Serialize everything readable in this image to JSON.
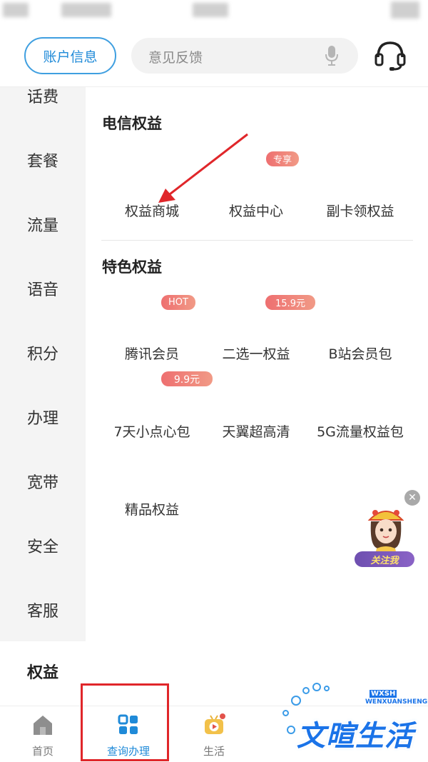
{
  "header": {
    "account_label": "账户信息",
    "search_placeholder": "意见反馈"
  },
  "sidebar": {
    "items": [
      {
        "label": "话费"
      },
      {
        "label": "套餐"
      },
      {
        "label": "流量"
      },
      {
        "label": "语音"
      },
      {
        "label": "积分"
      },
      {
        "label": "办理"
      },
      {
        "label": "宽带"
      },
      {
        "label": "安全"
      },
      {
        "label": "客服"
      },
      {
        "label": "权益",
        "active": true
      }
    ]
  },
  "main": {
    "telecom_section": {
      "title": "电信权益",
      "items": [
        {
          "label": "权益商城"
        },
        {
          "label": "权益中心",
          "badge": "专享"
        },
        {
          "label": "副卡领权益"
        }
      ]
    },
    "special_section": {
      "title": "特色权益",
      "items": [
        {
          "label": "腾讯会员",
          "badge": "HOT"
        },
        {
          "label": "二选一权益",
          "badge": "15.9元"
        },
        {
          "label": "B站会员包"
        },
        {
          "label": "7天小点心包",
          "badge": "9.9元"
        },
        {
          "label": "天翼超高清"
        },
        {
          "label": "5G流量权益包"
        },
        {
          "label": "精品权益"
        }
      ]
    }
  },
  "floating": {
    "follow_label": "关注我",
    "close_glyph": "✕"
  },
  "tabbar": {
    "tabs": [
      {
        "label": "首页",
        "icon": "home-icon"
      },
      {
        "label": "查询办理",
        "icon": "grid-icon",
        "active": true
      },
      {
        "label": "生活",
        "icon": "tv-play-icon"
      }
    ]
  },
  "watermark": {
    "text": "文暄生活",
    "latin": "WENXUANSHENGHUO",
    "abbr": "WXSH"
  },
  "colors": {
    "accent": "#1f8ad8",
    "badge": "#ee6f70",
    "annotation": "#e0262a"
  }
}
